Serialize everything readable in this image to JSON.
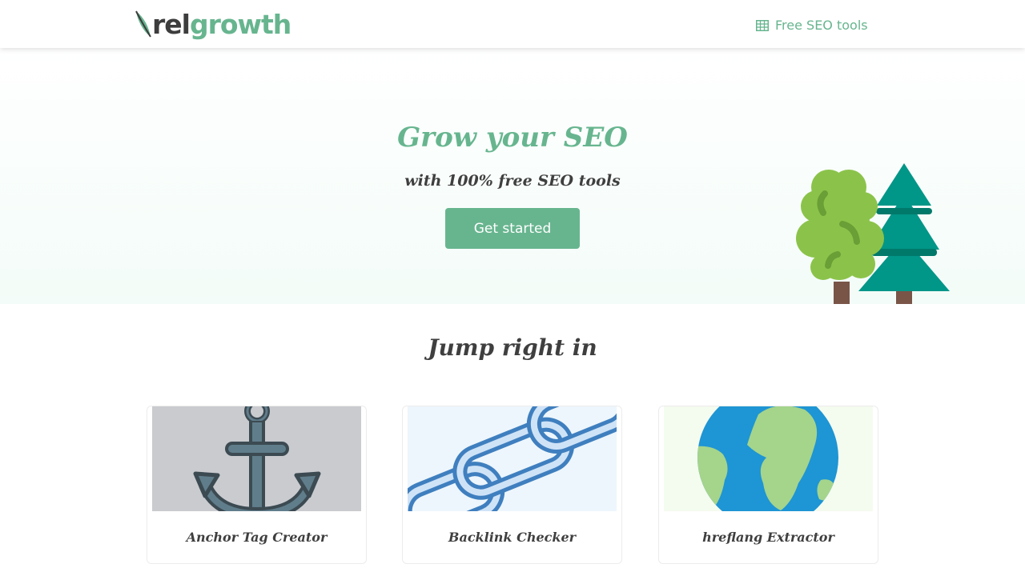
{
  "nav": {
    "logo_part1": "rel",
    "logo_part2": "growth",
    "link_label": "Free SEO tools",
    "link_icon": "table-icon"
  },
  "hero": {
    "title": "Grow your SEO",
    "subtitle": "with 100% free SEO tools",
    "cta_label": "Get started",
    "illustration": "trees-illustration"
  },
  "section": {
    "title": "Jump right in"
  },
  "tools": [
    {
      "label": "Anchor Tag Creator",
      "icon": "anchor-icon"
    },
    {
      "label": "Backlink Checker",
      "icon": "chain-link-icon"
    },
    {
      "label": "hreflang Extractor",
      "icon": "globe-icon"
    }
  ],
  "colors": {
    "brand_green": "#67b58f",
    "text_dark": "#3f3f3f",
    "tree_light": "#8bc34a",
    "tree_dark": "#009688",
    "trunk": "#795548"
  }
}
